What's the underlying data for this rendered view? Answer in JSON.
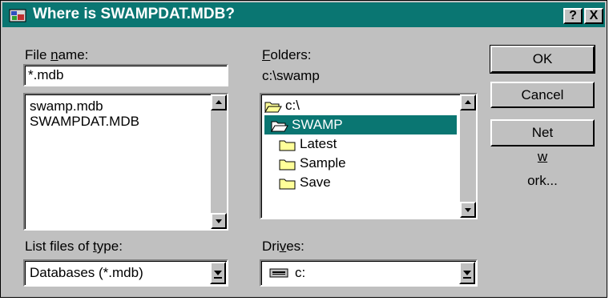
{
  "window": {
    "title": "Where is SWAMPDAT.MDB?",
    "help_label": "?",
    "close_label": "X"
  },
  "file_name": {
    "label_pre": "File ",
    "label_key": "n",
    "label_post": "ame:",
    "value": "*.mdb",
    "files": [
      "swamp.mdb",
      "SWAMPDAT.MDB"
    ]
  },
  "folders": {
    "label_key": "F",
    "label_post": "olders:",
    "current_path": "c:\\swamp",
    "items": [
      {
        "label": "c:\\",
        "icon": "open-folder-icon"
      },
      {
        "label": "SWAMP",
        "icon": "open-folder-icon",
        "selected": true
      },
      {
        "label": "Latest",
        "icon": "folder-icon"
      },
      {
        "label": "Sample",
        "icon": "folder-icon"
      },
      {
        "label": "Save",
        "icon": "folder-icon"
      }
    ]
  },
  "file_type": {
    "label_pre": "List files of ",
    "label_key": "t",
    "label_post": "ype:",
    "selected": "Databases (*.mdb)"
  },
  "drives": {
    "label_pre": "Dri",
    "label_key": "v",
    "label_post": "es:",
    "selected": "c:",
    "icon": "drive-icon"
  },
  "buttons": {
    "ok": "OK",
    "cancel": "Cancel",
    "network_pre": "Net",
    "network_key": "w",
    "network_post": "ork..."
  },
  "colors": {
    "title_bar": "#0a7672",
    "selection": "#0a7672",
    "face": "#c0c0c0",
    "folder_fill": "#ffff99"
  }
}
